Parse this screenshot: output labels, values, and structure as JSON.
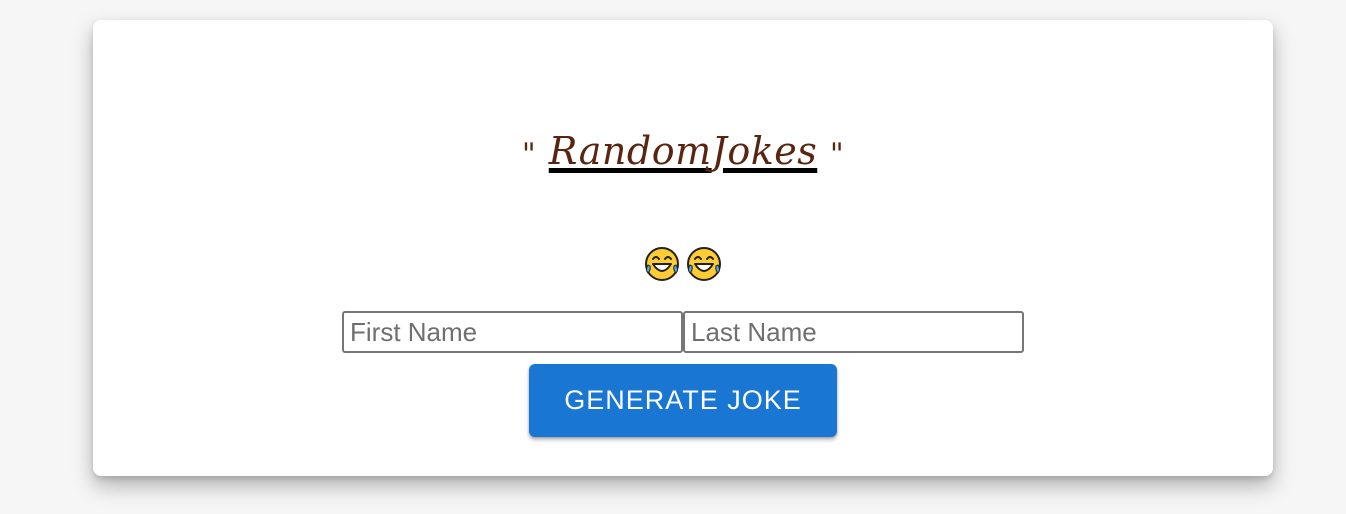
{
  "header": {
    "open_quote": "\"",
    "title_word_1": "Random",
    "title_word_2": "Jokes",
    "close_quote": "\""
  },
  "emoji": {
    "count": 2,
    "icon": "face-with-tears-of-joy-icon"
  },
  "form": {
    "first_name": {
      "placeholder": "First Name",
      "value": ""
    },
    "last_name": {
      "placeholder": "Last Name",
      "value": ""
    },
    "generate_label": "GENERATE JOKE"
  },
  "colors": {
    "title": "#5a2510",
    "button": "#1976d2",
    "button_text": "#ffffff",
    "background": "#f6f6f6",
    "card": "#ffffff"
  }
}
